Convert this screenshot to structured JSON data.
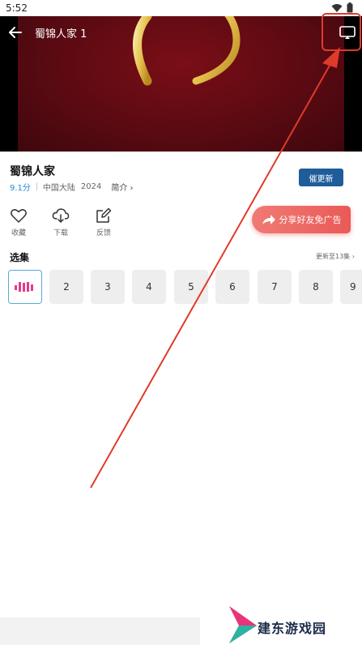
{
  "status_bar": {
    "time": "5:52",
    "wifi_icon": "wifi-icon",
    "battery_icon": "battery-icon"
  },
  "player": {
    "title": "蜀锦人家 1",
    "back_icon": "arrow-left-icon",
    "cast_icon": "cast-icon"
  },
  "show": {
    "title": "蜀锦人家",
    "rating": "9.1分",
    "region": "中国大陆",
    "year": "2024",
    "intro_label": "简介 ›",
    "remind_label": "催更新"
  },
  "actions": [
    {
      "label": "收藏",
      "icon": "heart-icon"
    },
    {
      "label": "下载",
      "icon": "download-cloud-icon"
    },
    {
      "label": "反馈",
      "icon": "edit-icon"
    }
  ],
  "share": {
    "label": "分享好友免广告",
    "icon": "share-arrow-icon"
  },
  "episodes": {
    "header": "选集",
    "update_label": "更新至13集 ›",
    "playing_icon": "playing-bars-icon",
    "items": [
      "2",
      "3",
      "4",
      "5",
      "6",
      "7",
      "8",
      "9"
    ]
  },
  "watermark": {
    "text": "建东游戏园",
    "logo_icon": "triangle-logo-icon"
  },
  "colors": {
    "accent_blue": "#1f5c9a",
    "rating_blue": "#1e8ed8",
    "share_red": "#ea5a57",
    "playing_pink": "#e83a8a",
    "annotation_red": "#e03a2a"
  }
}
